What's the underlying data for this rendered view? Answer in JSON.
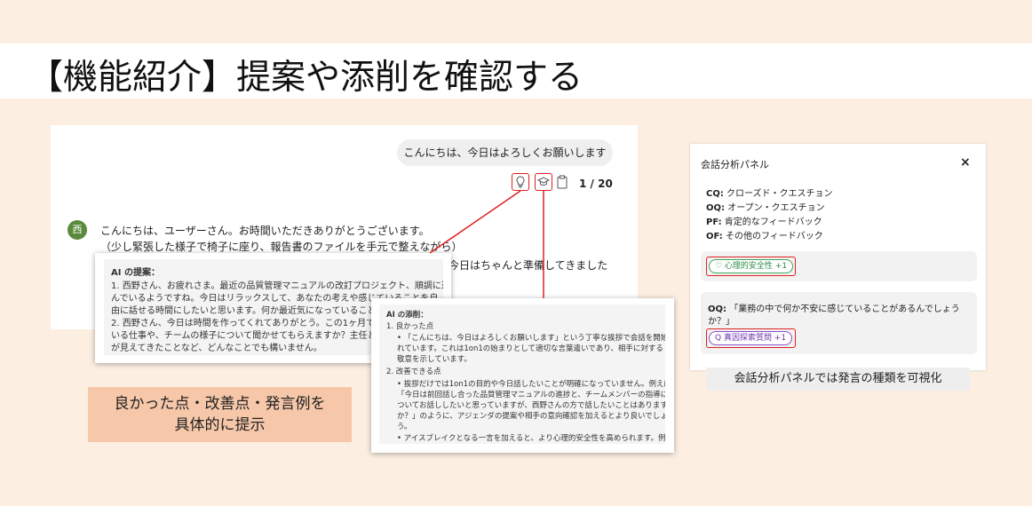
{
  "title": "【機能紹介】提案や添削を確認する",
  "chat": {
    "user_message": "こんにちは、今日はよろしくお願いします",
    "toolbar": {
      "hint_icon": "lightbulb-icon",
      "coach_icon": "graduation-cap-icon",
      "copy_icon": "clipboard-icon",
      "page_count": "1 / 20"
    },
    "avatar_label": "西",
    "ai_reply_line1": "こんにちは、ユーザーさん。お時間いただきありがとうございます。",
    "ai_reply_line2": "（少し緊張した様子で椅子に座り、報告書のファイルを手元で整えながら）",
    "ai_reply_line3_tail": "今日はちゃんと準備してきました"
  },
  "suggestion": {
    "title": "AI の提案：",
    "lines": [
      "1. 西野さん、お疲れさま。最近の品質管理マニュアルの改訂プロジェクト、順調に進",
      "    んでいるようですね。今日はリラックスして、あなたの考えや感じていることを自",
      "    由に話せる時間にしたいと思います。何か最近気になっていること",
      "2. 西野さん、今日は時間を作ってくれてありがとう。この1ヶ月で特に",
      "    いる仕事や、チームの様子について聞かせてもらえますか？主任と",
      "    が見えてきたことなど、どんなことでも構いません。"
    ]
  },
  "correction": {
    "title": "AI の添削：",
    "good_heading": "1. 良かった点",
    "good_lines": [
      "•  「こんにちは、今日はよろしくお願いします」という丁寧な挨拶で会話を開始さ",
      "    れています。これは1on1の始まりとして適切な言葉遣いであり、相手に対する",
      "    敬意を示しています。"
    ],
    "improve_heading": "2. 改善できる点",
    "improve_lines": [
      "•  挨拶だけでは1on1の目的や今日話したいことが明確になっていません。例えば",
      "    「今日は前回話し合った品質管理マニュアルの進捗と、チームメンバーの指導に",
      "    ついてお話ししたいと思っていますが、西野さんの方で話したいことはあります",
      "    か？」のように、アジェンダの提案や相手の意向確認を加えるとより良いでしょ",
      "    う。",
      "•  アイスブレイクとなる一言を加えると、より心理的安全性を高められます。例え"
    ]
  },
  "callout_left": {
    "line1": "良かった点・改善点・発言例を",
    "line2": "具体的に提示"
  },
  "analysis_panel": {
    "title": "会話分析パネル",
    "close": "×",
    "legend": [
      {
        "code": "CQ:",
        "text": " クローズド・クエスチョン"
      },
      {
        "code": "OQ:",
        "text": " オープン・クエスチョン"
      },
      {
        "code": "PF:",
        "text": " 肯定的なフィードバック"
      },
      {
        "code": "OF:",
        "text": " その他のフィードバック"
      }
    ],
    "card1_tag": "♡ 心理的安全性 +1",
    "card2_code": "OQ:",
    "card2_line1": " 「業務の中で何か不安に感じていることがあるんでしょう",
    "card2_line2": "か？」",
    "card2_tag": "Q 真因探索質問 +1",
    "caption": "会話分析パネルでは発言の種類を可視化"
  },
  "colors": {
    "background": "#fcefe2",
    "highlight_red": "#e02020",
    "callout": "#f6c7a9",
    "avatar": "#5b8a3c"
  }
}
